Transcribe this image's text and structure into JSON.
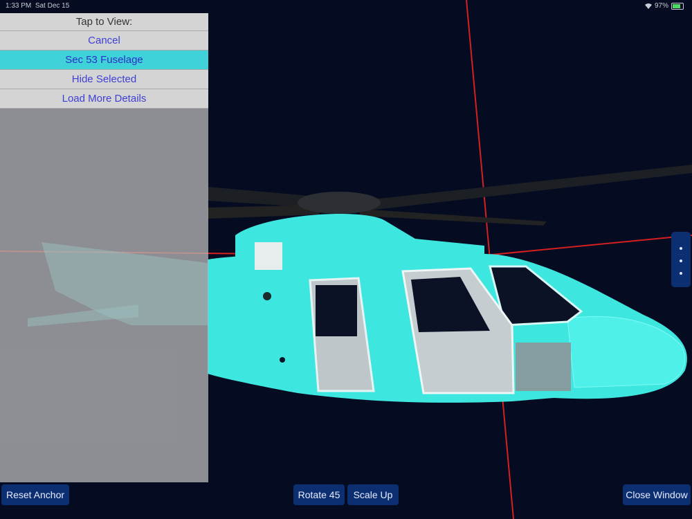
{
  "status_bar": {
    "time": "1:33 PM",
    "date": "Sat Dec 15",
    "battery": "97%"
  },
  "menu": {
    "header": "Tap to View:",
    "items": [
      {
        "label": "Cancel",
        "selected": false
      },
      {
        "label": "Sec 53 Fuselage",
        "selected": true
      },
      {
        "label": "Hide Selected",
        "selected": false
      },
      {
        "label": "Load More Details",
        "selected": false
      }
    ]
  },
  "buttons": {
    "reset_anchor": "Reset Anchor",
    "rotate": "Rotate 45",
    "scale_up": "Scale Up",
    "close_window": "Close Window"
  },
  "colors": {
    "background": "#050c21",
    "fuselage": "#3ee6e0",
    "button": "#0c2f72",
    "selected_item": "#3fd3d9",
    "axis": "#d61f1f"
  }
}
